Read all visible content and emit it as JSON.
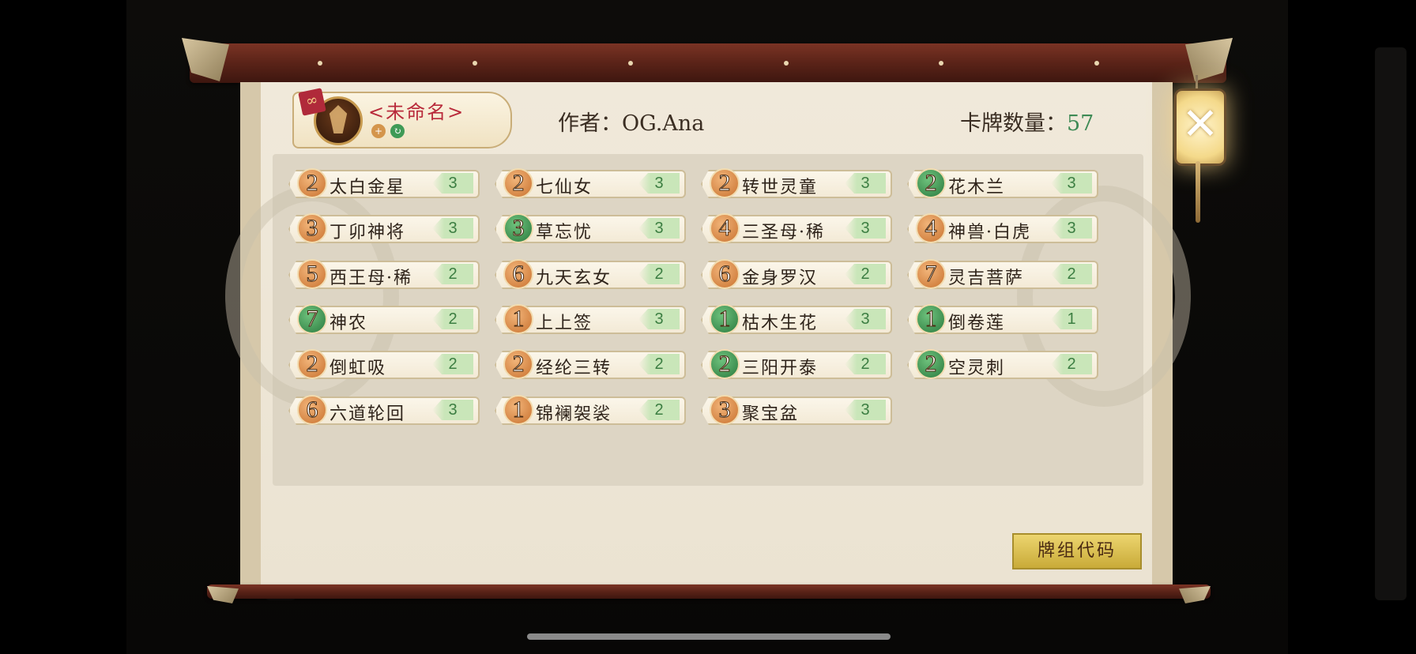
{
  "deck": {
    "name": "<未命名>",
    "author_text": "作者：OG.Ana",
    "count_label": "卡牌数量：",
    "count_value": "57"
  },
  "cards": [
    {
      "cost": "2",
      "cost_color": "orange",
      "name": "太白金星",
      "qty": "3"
    },
    {
      "cost": "2",
      "cost_color": "orange",
      "name": "七仙女",
      "qty": "3"
    },
    {
      "cost": "2",
      "cost_color": "orange",
      "name": "转世灵童",
      "qty": "3"
    },
    {
      "cost": "2",
      "cost_color": "green",
      "name": "花木兰",
      "qty": "3"
    },
    {
      "cost": "3",
      "cost_color": "orange",
      "name": "丁卯神将",
      "qty": "3"
    },
    {
      "cost": "3",
      "cost_color": "green",
      "name": "草忘忧",
      "qty": "3"
    },
    {
      "cost": "4",
      "cost_color": "orange",
      "name": "三圣母·稀",
      "qty": "3"
    },
    {
      "cost": "4",
      "cost_color": "orange",
      "name": "神兽·白虎",
      "qty": "3"
    },
    {
      "cost": "5",
      "cost_color": "orange",
      "name": "西王母·稀",
      "qty": "2"
    },
    {
      "cost": "6",
      "cost_color": "orange",
      "name": "九天玄女",
      "qty": "2"
    },
    {
      "cost": "6",
      "cost_color": "orange",
      "name": "金身罗汉",
      "qty": "2"
    },
    {
      "cost": "7",
      "cost_color": "orange",
      "name": "灵吉菩萨",
      "qty": "2"
    },
    {
      "cost": "7",
      "cost_color": "green",
      "name": "神农",
      "qty": "2"
    },
    {
      "cost": "1",
      "cost_color": "orange",
      "name": "上上签",
      "qty": "3"
    },
    {
      "cost": "1",
      "cost_color": "green",
      "name": "枯木生花",
      "qty": "3"
    },
    {
      "cost": "1",
      "cost_color": "green",
      "name": "倒卷莲",
      "qty": "1"
    },
    {
      "cost": "2",
      "cost_color": "orange",
      "name": "倒虹吸",
      "qty": "2"
    },
    {
      "cost": "2",
      "cost_color": "orange",
      "name": "经纶三转",
      "qty": "2"
    },
    {
      "cost": "2",
      "cost_color": "green",
      "name": "三阳开泰",
      "qty": "2"
    },
    {
      "cost": "2",
      "cost_color": "green",
      "name": "空灵刺",
      "qty": "2"
    },
    {
      "cost": "6",
      "cost_color": "orange",
      "name": "六道轮回",
      "qty": "3"
    },
    {
      "cost": "1",
      "cost_color": "orange",
      "name": "锦襕袈裟",
      "qty": "2"
    },
    {
      "cost": "3",
      "cost_color": "orange",
      "name": "聚宝盆",
      "qty": "3"
    }
  ],
  "buttons": {
    "deck_code": "牌组代码",
    "close": "✕"
  },
  "icons": {
    "link": "link-icon",
    "add": "add-icon",
    "refresh": "refresh-icon",
    "close": "close-icon"
  }
}
